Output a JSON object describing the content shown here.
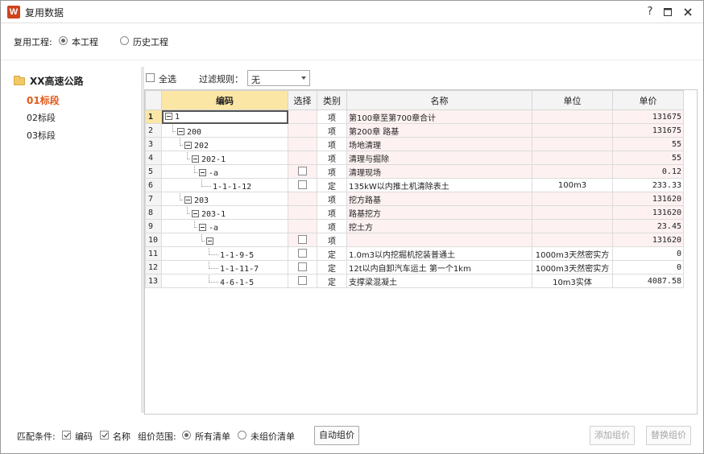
{
  "window": {
    "title": "复用数据",
    "app_icon": "W",
    "help_label": "?",
    "icons": {
      "help": "question-icon",
      "maximize": "maximize-icon",
      "close": "close-icon"
    }
  },
  "reuse": {
    "label": "复用工程:",
    "options": [
      {
        "label": "本工程",
        "selected": true
      },
      {
        "label": "历史工程",
        "selected": false
      }
    ]
  },
  "tree": {
    "root": "XX高速公路",
    "items": [
      {
        "label": "01标段",
        "selected": true
      },
      {
        "label": "02标段",
        "selected": false
      },
      {
        "label": "03标段",
        "selected": false
      }
    ]
  },
  "filter": {
    "select_all_label": "全选",
    "select_all_checked": false,
    "rule_label": "过滤规则：",
    "rule_value": "无"
  },
  "grid": {
    "headers": {
      "code": "编码",
      "select": "选择",
      "type": "类别",
      "name": "名称",
      "unit": "单位",
      "price": "单价"
    },
    "rows": [
      {
        "n": "1",
        "level": 0,
        "expander": true,
        "code": "1",
        "checkbox": false,
        "type": "项",
        "name": "第100章至第700章合计",
        "unit": "",
        "price": "131675"
      },
      {
        "n": "2",
        "level": 1,
        "expander": true,
        "code": "200",
        "checkbox": false,
        "type": "项",
        "name": "第200章 路基",
        "unit": "",
        "price": "131675"
      },
      {
        "n": "3",
        "level": 2,
        "expander": true,
        "code": "202",
        "checkbox": false,
        "type": "项",
        "name": "场地清理",
        "unit": "",
        "price": "55"
      },
      {
        "n": "4",
        "level": 3,
        "expander": true,
        "code": "202-1",
        "checkbox": false,
        "type": "项",
        "name": "清理与掘除",
        "unit": "",
        "price": "55"
      },
      {
        "n": "5",
        "level": 4,
        "expander": true,
        "code": "-a",
        "checkbox": true,
        "type": "项",
        "name": "清理现场",
        "unit": "",
        "price": "0.12"
      },
      {
        "n": "6",
        "level": 5,
        "expander": false,
        "code": "1-1-1-12",
        "checkbox": true,
        "type": "定",
        "name": "135kW以内推土机清除表土",
        "unit": "100m3",
        "price": "233.33"
      },
      {
        "n": "7",
        "level": 2,
        "expander": true,
        "code": "203",
        "checkbox": false,
        "type": "项",
        "name": "挖方路基",
        "unit": "",
        "price": "131620"
      },
      {
        "n": "8",
        "level": 3,
        "expander": true,
        "code": "203-1",
        "checkbox": false,
        "type": "项",
        "name": "路基挖方",
        "unit": "",
        "price": "131620"
      },
      {
        "n": "9",
        "level": 4,
        "expander": true,
        "code": "-a",
        "checkbox": false,
        "type": "项",
        "name": "挖土方",
        "unit": "",
        "price": "23.45"
      },
      {
        "n": "10",
        "level": 5,
        "expander": true,
        "code": "",
        "checkbox": true,
        "type": "项",
        "name": "",
        "unit": "",
        "price": "131620"
      },
      {
        "n": "11",
        "level": 6,
        "expander": false,
        "code": "1-1-9-5",
        "checkbox": true,
        "type": "定",
        "name": "1.0m3以内挖掘机挖装普通土",
        "unit": "1000m3天然密实方",
        "price": "0"
      },
      {
        "n": "12",
        "level": 6,
        "expander": false,
        "code": "1-1-11-7",
        "checkbox": true,
        "type": "定",
        "name": "12t以内自卸汽车运土 第一个1km",
        "unit": "1000m3天然密实方",
        "price": "0"
      },
      {
        "n": "13",
        "level": 6,
        "expander": false,
        "code": "4-6-1-5",
        "checkbox": true,
        "type": "定",
        "name": "支撑梁混凝土",
        "unit": "10m3实体",
        "price": "4087.58"
      }
    ]
  },
  "bottom": {
    "match_label": "匹配条件:",
    "match_code_label": "编码",
    "match_code_checked": true,
    "match_name_label": "名称",
    "match_name_checked": true,
    "scope_label": "组价范围:",
    "scope_options": [
      {
        "label": "所有清单",
        "selected": true
      },
      {
        "label": "未组价清单",
        "selected": false
      }
    ],
    "auto_button": "自动组价",
    "add_button": "添加组价",
    "replace_button": "替换组价"
  }
}
